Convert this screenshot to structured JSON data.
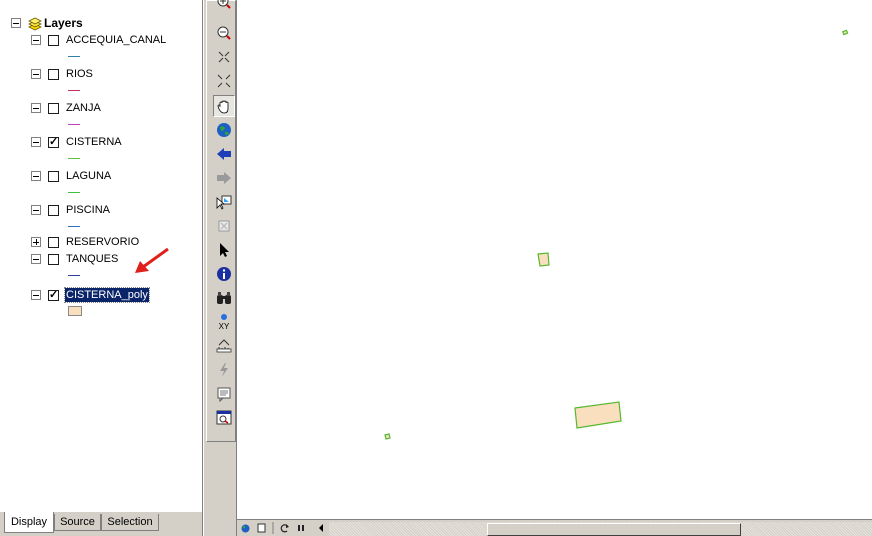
{
  "toc": {
    "title": "Layers",
    "layers": [
      {
        "name": "ACCEQUIA_CANAL",
        "checked": false,
        "expanded": true,
        "symbol": "line",
        "color": "#2f7fa7"
      },
      {
        "name": "RIOS",
        "checked": false,
        "expanded": true,
        "symbol": "line",
        "color": "#c0315a"
      },
      {
        "name": "ZANJA",
        "checked": false,
        "expanded": true,
        "symbol": "line",
        "color": "#c040c0"
      },
      {
        "name": "CISTERNA",
        "checked": true,
        "expanded": true,
        "symbol": "line",
        "color": "#5fbf3f"
      },
      {
        "name": "LAGUNA",
        "checked": false,
        "expanded": true,
        "symbol": "line",
        "color": "#3fbf3f"
      },
      {
        "name": "PISCINA",
        "checked": false,
        "expanded": true,
        "symbol": "line",
        "color": "#2f6fbf"
      },
      {
        "name": "RESERVORIO",
        "checked": false,
        "expanded": false
      },
      {
        "name": "TANQUES",
        "checked": false,
        "expanded": true,
        "symbol": "line",
        "color": "#2f3fa0"
      },
      {
        "name": "CISTERNA_poly",
        "checked": true,
        "expanded": true,
        "selected": true,
        "symbol": "polygon",
        "color": "#fadfbf"
      }
    ]
  },
  "tabs": [
    {
      "label": "Display",
      "active": true
    },
    {
      "label": "Source",
      "active": false
    },
    {
      "label": "Selection",
      "active": false
    }
  ],
  "tools": [
    "zoom-in-icon",
    "zoom-out-icon",
    "fixed-zoom-in-icon",
    "fixed-zoom-out-icon",
    "pan-icon",
    "full-extent-icon",
    "back-extent-icon",
    "forward-extent-icon",
    "select-features-icon",
    "clear-selection-icon",
    "select-elements-icon",
    "identify-icon",
    "find-icon",
    "go-to-xy-icon",
    "measure-icon",
    "hyperlink-icon",
    "html-popup-icon",
    "magnifier-window-icon"
  ],
  "status_buttons": [
    "globe-icon",
    "layout-view-icon",
    "refresh-icon",
    "pause-icon",
    "scroll-left-icon"
  ],
  "colors": {
    "selection": "#0a246a",
    "feature_fill": "#fadfbf",
    "feature_outline": "#57b82f",
    "arrow": "#e0201a"
  }
}
